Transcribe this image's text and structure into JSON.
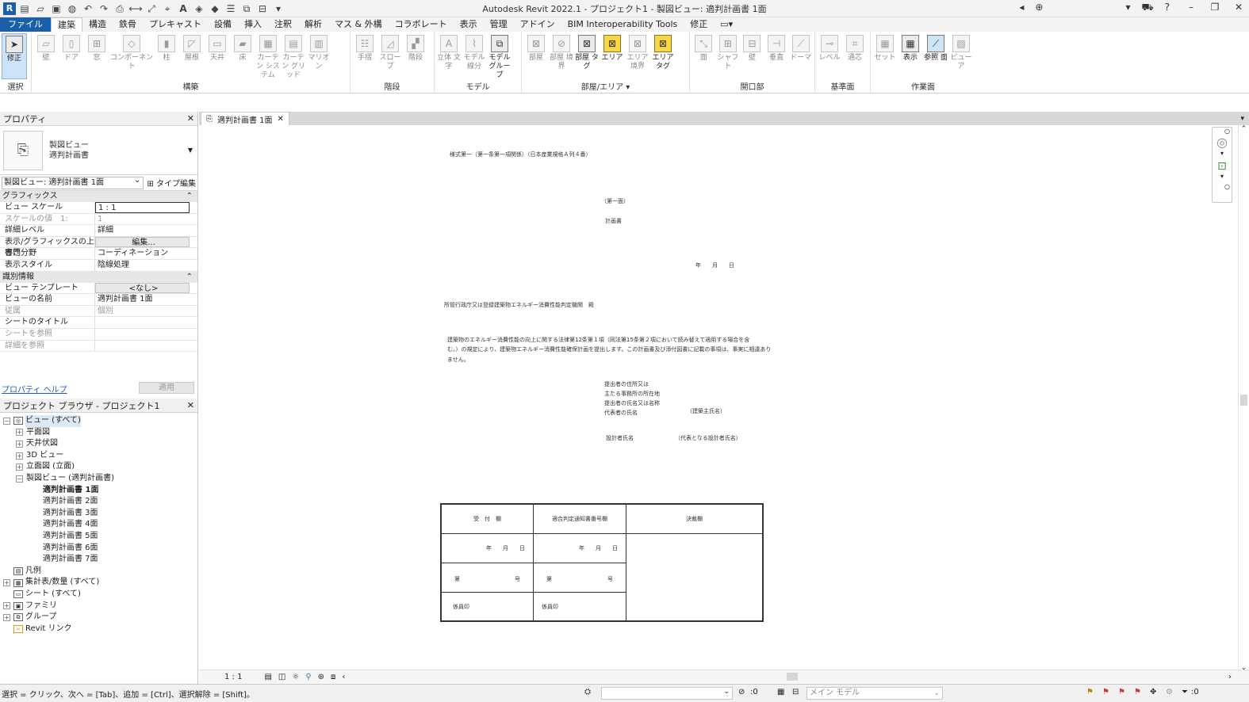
{
  "window": {
    "title": "Autodesk Revit 2022.1 - プロジェクト1 - 製図ビュー: 適判計画書 1面"
  },
  "ribbon_tabs": [
    "ファイル",
    "建築",
    "構造",
    "鉄骨",
    "プレキャスト",
    "設備",
    "挿入",
    "注釈",
    "解析",
    "マス & 外構",
    "コラボレート",
    "表示",
    "管理",
    "アドイン",
    "BIM Interoperability Tools",
    "修正"
  ],
  "ribbon": {
    "select_label": "選択",
    "modify": "修正",
    "build_panel": "構築",
    "circulation_panel": "階段",
    "model_panel": "モデル",
    "room_panel": "部屋/エリア",
    "opening_panel": "開口部",
    "datum_panel": "基準面",
    "workplane_panel": "作業面",
    "tools_build": [
      "壁",
      "ドア",
      "窓",
      "コンポーネント",
      "柱",
      "屋根",
      "天井",
      "床",
      "カーテン システム",
      "カーテン グリッド",
      "マリオン"
    ],
    "tools_circ": [
      "手摺",
      "スロープ",
      "階段"
    ],
    "tools_model": [
      "立体 文字",
      "モデル 線分",
      "モデル グループ"
    ],
    "tools_room": [
      "部屋",
      "部屋 境界",
      "部屋 タグ",
      "エリア",
      "エリア 境界",
      "エリア タグ"
    ],
    "tools_open": [
      "面",
      "シャフト",
      "壁",
      "垂直",
      "ドーマ"
    ],
    "tools_datum": [
      "レベル",
      "通芯"
    ],
    "tools_wp": [
      "セット",
      "表示",
      "参照 面",
      "ビューア"
    ]
  },
  "properties": {
    "title": "プロパティ",
    "type_line1": "製図ビュー",
    "type_line2": "適判計画書",
    "selector": "製図ビュー: 適判計画書 1面",
    "type_edit": "タイプ編集",
    "graphics_group": "グラフィックス",
    "rows_graphics": [
      {
        "k": "ビュー スケール",
        "v": "1 : 1"
      },
      {
        "k": "スケールの値　1:",
        "v": "1"
      },
      {
        "k": "詳細レベル",
        "v": "詳細"
      },
      {
        "k": "表示/グラフィックスの上書き",
        "v": "編集..."
      },
      {
        "k": "専門分野",
        "v": "コーディネーション"
      },
      {
        "k": "表示スタイル",
        "v": "陰線処理"
      }
    ],
    "identity_group": "識別情報",
    "rows_identity": [
      {
        "k": "ビュー テンプレート",
        "v": "<なし>"
      },
      {
        "k": "ビューの名前",
        "v": "適判計画書 1面"
      },
      {
        "k": "従属",
        "v": "個別"
      },
      {
        "k": "シートのタイトル",
        "v": ""
      },
      {
        "k": "シートを参照",
        "v": ""
      },
      {
        "k": "詳細を参照",
        "v": ""
      }
    ],
    "help_link": "プロパティ ヘルプ",
    "apply": "適用"
  },
  "browser": {
    "title": "プロジェクト ブラウザ - プロジェクト1",
    "views_all": "ビュー (すべて)",
    "floor_plans": "平面図",
    "ceiling_plans": "天井伏図",
    "views_3d": "3D ビュー",
    "elevations": "立面図 (立面)",
    "drafting": "製図ビュー (適判計画書)",
    "drafting_children": [
      "適判計画書 1面",
      "適判計画書 2面",
      "適判計画書 3面",
      "適判計画書 4面",
      "適判計画書 5面",
      "適判計画書 6面",
      "適判計画書 7面"
    ],
    "legends": "凡例",
    "schedules": "集計表/数量 (すべて)",
    "sheets": "シート (すべて)",
    "families": "ファミリ",
    "groups": "グループ",
    "links": "Revit リンク"
  },
  "document_tab": "適判計画書 1面",
  "doc": {
    "form_line": "様式第一（第一条第一項関係）（日本産業規格Ａ列４番）",
    "page": "（第一面）",
    "title": "計画書",
    "date": "年　　月　　日",
    "addressee": "所管行政庁又は登録建築物エネルギー消費性能判定機関　殿",
    "body1": "建築物のエネルギー消費性能の向上に関する法律第12条第１項（同法第15条第２項において読み替えて適用する場合を含",
    "body2": "む。）の規定により、建築物エネルギー消費性能確保計画を提出します。この計画書及び添付図書に記載の事項は、事実に相違あり",
    "body3": "ません。",
    "sub1": "提出者の住所又は",
    "sub2": "主たる事務所の所在地",
    "sub3": "提出者の氏名又は名称",
    "sub4": "代表者の氏名",
    "owner": "（建築主氏名）",
    "designer_label": "設計者氏名",
    "designer": "（代表となる設計者氏名）",
    "table": {
      "h1": "受　付　欄",
      "h2": "適合判定通知書番号欄",
      "h3": "決裁欄",
      "date": "年　　月　　日",
      "no_l": "第",
      "no_r": "号",
      "staff": "係員印"
    }
  },
  "viewbar": {
    "scale": "1 : 1"
  },
  "status": {
    "hint": "選択 = クリック、次へ = [Tab]、追加 = [Ctrl]、選択解除 = [Shift]。",
    "zero1": ":0",
    "model": "メイン モデル",
    "zero2": ":0"
  }
}
